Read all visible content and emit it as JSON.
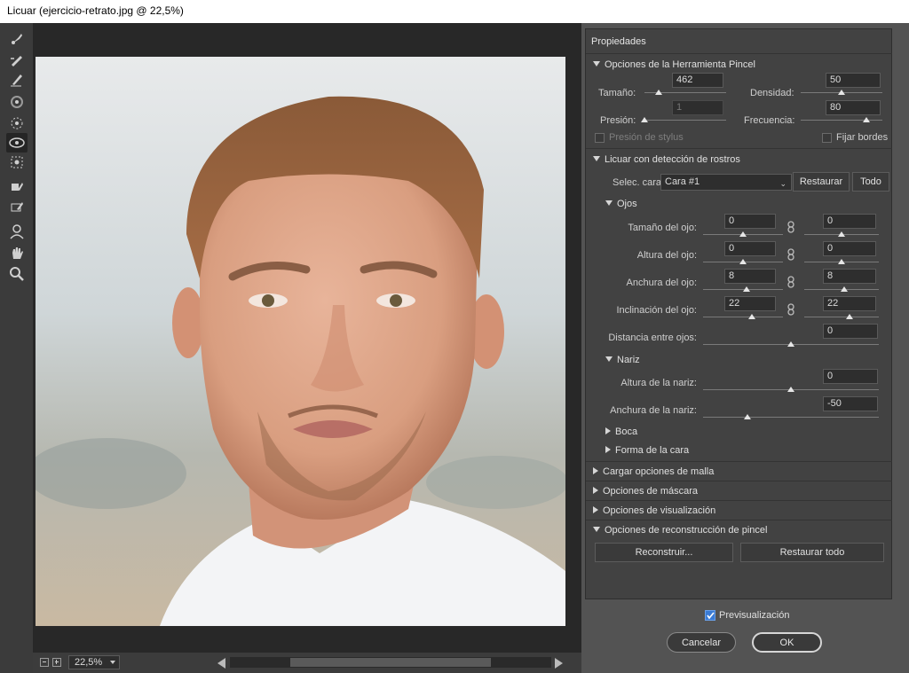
{
  "window": {
    "title": "Licuar (ejercicio-retrato.jpg @ 22,5%)"
  },
  "toolbar": {
    "tools": [
      "forward-warp",
      "reconstruct",
      "smooth",
      "twirl-clockwise",
      "pucker",
      "face",
      "bloat",
      "push-left",
      "freeze-mask",
      "thaw-mask",
      "face-tool",
      "hand",
      "zoom"
    ],
    "active_tool": "face-tool"
  },
  "canvas": {
    "zoom": "22,5%"
  },
  "panel": {
    "title": "Propiedades",
    "brush": {
      "header": "Opciones de la Herramienta Pincel",
      "size_label": "Tamaño:",
      "size_value": "462",
      "size_level": 0.17,
      "density_label": "Densidad:",
      "density_value": "50",
      "density_level": 0.5,
      "pressure_label": "Presión:",
      "pressure_value": "1",
      "pressure_level": 0.0,
      "rate_label": "Frecuencia:",
      "rate_value": "80",
      "rate_level": 0.8,
      "stylus_label": "Presión de stylus",
      "stylus_checked": false,
      "pin_label": "Fijar bordes",
      "pin_checked": false
    },
    "face": {
      "header": "Licuar con detección de rostros",
      "select_label": "Selec. cara:",
      "select_value": "Cara #1",
      "restore_label": "Restaurar",
      "all_label": "Todo",
      "eyes": {
        "header": "Ojos",
        "rows": [
          {
            "label": "Tamaño del ojo:",
            "left": "0",
            "right": "0",
            "left_level": 0.5,
            "right_level": 0.5
          },
          {
            "label": "Altura del ojo:",
            "left": "0",
            "right": "0",
            "left_level": 0.5,
            "right_level": 0.5
          },
          {
            "label": "Anchura del ojo:",
            "left": "8",
            "right": "8",
            "left_level": 0.54,
            "right_level": 0.54
          },
          {
            "label": "Inclinación del ojo:",
            "left": "22",
            "right": "22",
            "left_level": 0.61,
            "right_level": 0.61
          }
        ],
        "distance_label": "Distancia entre ojos:",
        "distance_value": "0",
        "distance_level": 0.5
      },
      "nose": {
        "header": "Nariz",
        "height_label": "Altura de la nariz:",
        "height_value": "0",
        "height_level": 0.5,
        "width_label": "Anchura de la nariz:",
        "width_value": "-50",
        "width_level": 0.25
      },
      "mouth_label": "Boca",
      "shape_label": "Forma de la cara"
    },
    "mesh_label": "Cargar opciones de malla",
    "mask_label": "Opciones de máscara",
    "view_label": "Opciones de visualización",
    "reconstruct": {
      "header": "Opciones de reconstrucción de pincel",
      "reconstruct_label": "Reconstruir...",
      "restore_all_label": "Restaurar todo"
    }
  },
  "footer": {
    "preview_label": "Previsualización",
    "preview_checked": true,
    "cancel_label": "Cancelar",
    "ok_label": "OK"
  },
  "colors": {
    "accent": "#4a90d9",
    "panel": "#424242",
    "canvas": "#282828"
  }
}
